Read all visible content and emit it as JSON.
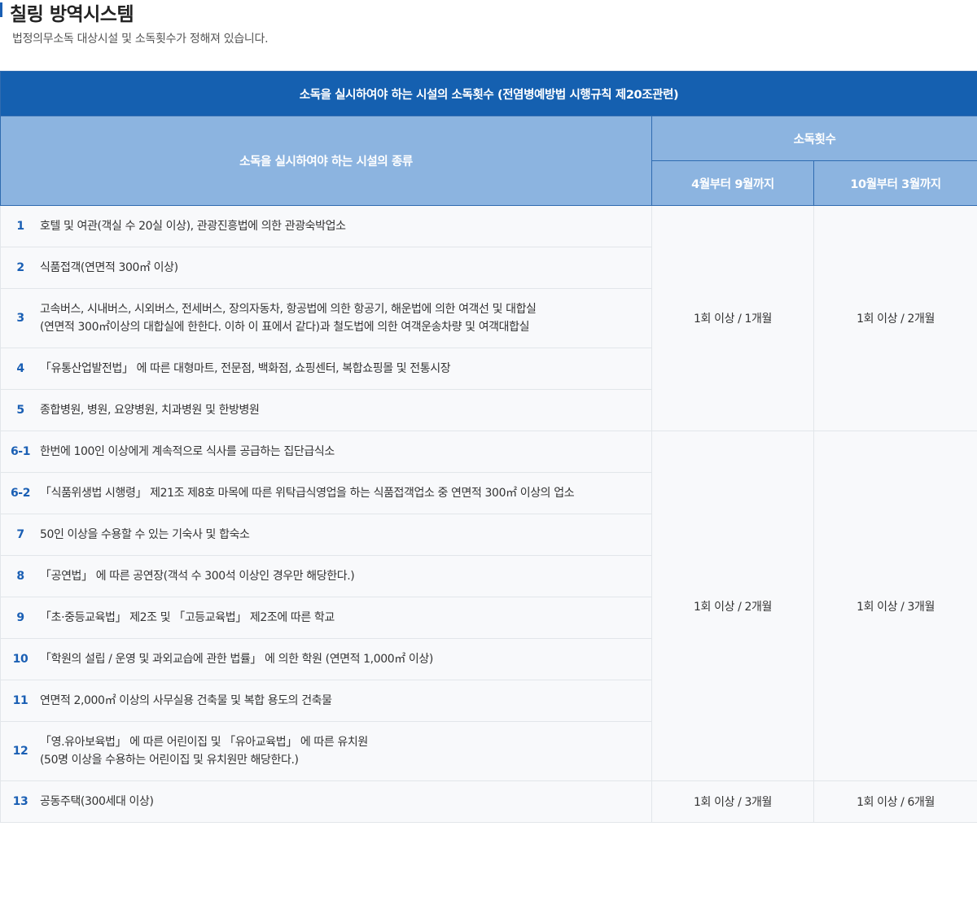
{
  "header": {
    "title": "칠링 방역시스템",
    "subtitle": "법정의무소독 대상시설 및 소독횟수가 정해져 있습니다."
  },
  "table": {
    "caption": "소독을 실시하여야 하는 시설의 소독횟수 (전염병예방법 시행규칙 제20조관련)",
    "col_facility": "소독을 실시하여야 하는 시설의 종류",
    "col_freq": "소독횟수",
    "col_summer": "4월부터 9월까지",
    "col_winter": "10월부터 3월까지",
    "rows": [
      {
        "num": "1",
        "lines": [
          "호텔 및 여관(객실 수 20실 이상), 관광진흥법에 의한 관광숙박업소"
        ]
      },
      {
        "num": "2",
        "lines": [
          "식품접객(연면적 300㎡ 이상)"
        ]
      },
      {
        "num": "3",
        "lines": [
          "고속버스, 시내버스, 시외버스, 전세버스, 장의자동차, 항공법에 의한 항공기, 해운법에 의한 여객선 및 대합실",
          "(연면적 300㎡이상의 대합실에 한한다. 이하 이 표에서 같다)과 철도법에 의한 여객운송차량 및 여객대합실"
        ]
      },
      {
        "num": "4",
        "lines": [
          "「유통산업발전법」 에 따른 대형마트, 전문점, 백화점, 쇼핑센터, 복합쇼핑몰 및 전통시장"
        ]
      },
      {
        "num": "5",
        "lines": [
          "종합병원, 병원, 요양병원, 치과병원 및 한방병원"
        ]
      },
      {
        "num": "6-1",
        "lines": [
          "한번에 100인 이상에게 계속적으로 식사를 공급하는 집단급식소"
        ]
      },
      {
        "num": "6-2",
        "lines": [
          "「식품위생법 시행령」 제21조 제8호 마목에 따른 위탁급식영업을 하는 식품접객업소 중 연면적 300㎡ 이상의 업소"
        ]
      },
      {
        "num": "7",
        "lines": [
          "50인 이상을 수용할 수 있는 기숙사 및 합숙소"
        ]
      },
      {
        "num": "8",
        "lines": [
          "「공연법」 에 따른 공연장(객석 수 300석 이상인 경우만 해당한다.)"
        ]
      },
      {
        "num": "9",
        "lines": [
          "「초·중등교육법」 제2조 및 「고등교육법」 제2조에 따른 학교"
        ]
      },
      {
        "num": "10",
        "lines": [
          "「학원의 설립 / 운영 및 과외교습에 관한 법률」 에 의한 학원 (연면적 1,000㎡ 이상)"
        ]
      },
      {
        "num": "11",
        "lines": [
          "연면적 2,000㎡ 이상의 사무실용 건축물 및 복합 용도의 건축물"
        ]
      },
      {
        "num": "12",
        "lines": [
          "「영.유아보육법」 에 따른 어린이집 및 「유아교육법」 에 따른 유치원",
          "(50명 이상을 수용하는 어린이집 및 유치원만 해당한다.)"
        ]
      },
      {
        "num": "13",
        "lines": [
          "공동주택(300세대 이상)"
        ]
      }
    ],
    "groups": [
      {
        "summer": "1회 이상 / 1개월",
        "winter": "1회 이상 / 2개월"
      },
      {
        "summer": "1회 이상 / 2개월",
        "winter": "1회 이상 / 3개월"
      },
      {
        "summer": "1회 이상 / 3개월",
        "winter": "1회 이상 / 6개월"
      }
    ]
  }
}
